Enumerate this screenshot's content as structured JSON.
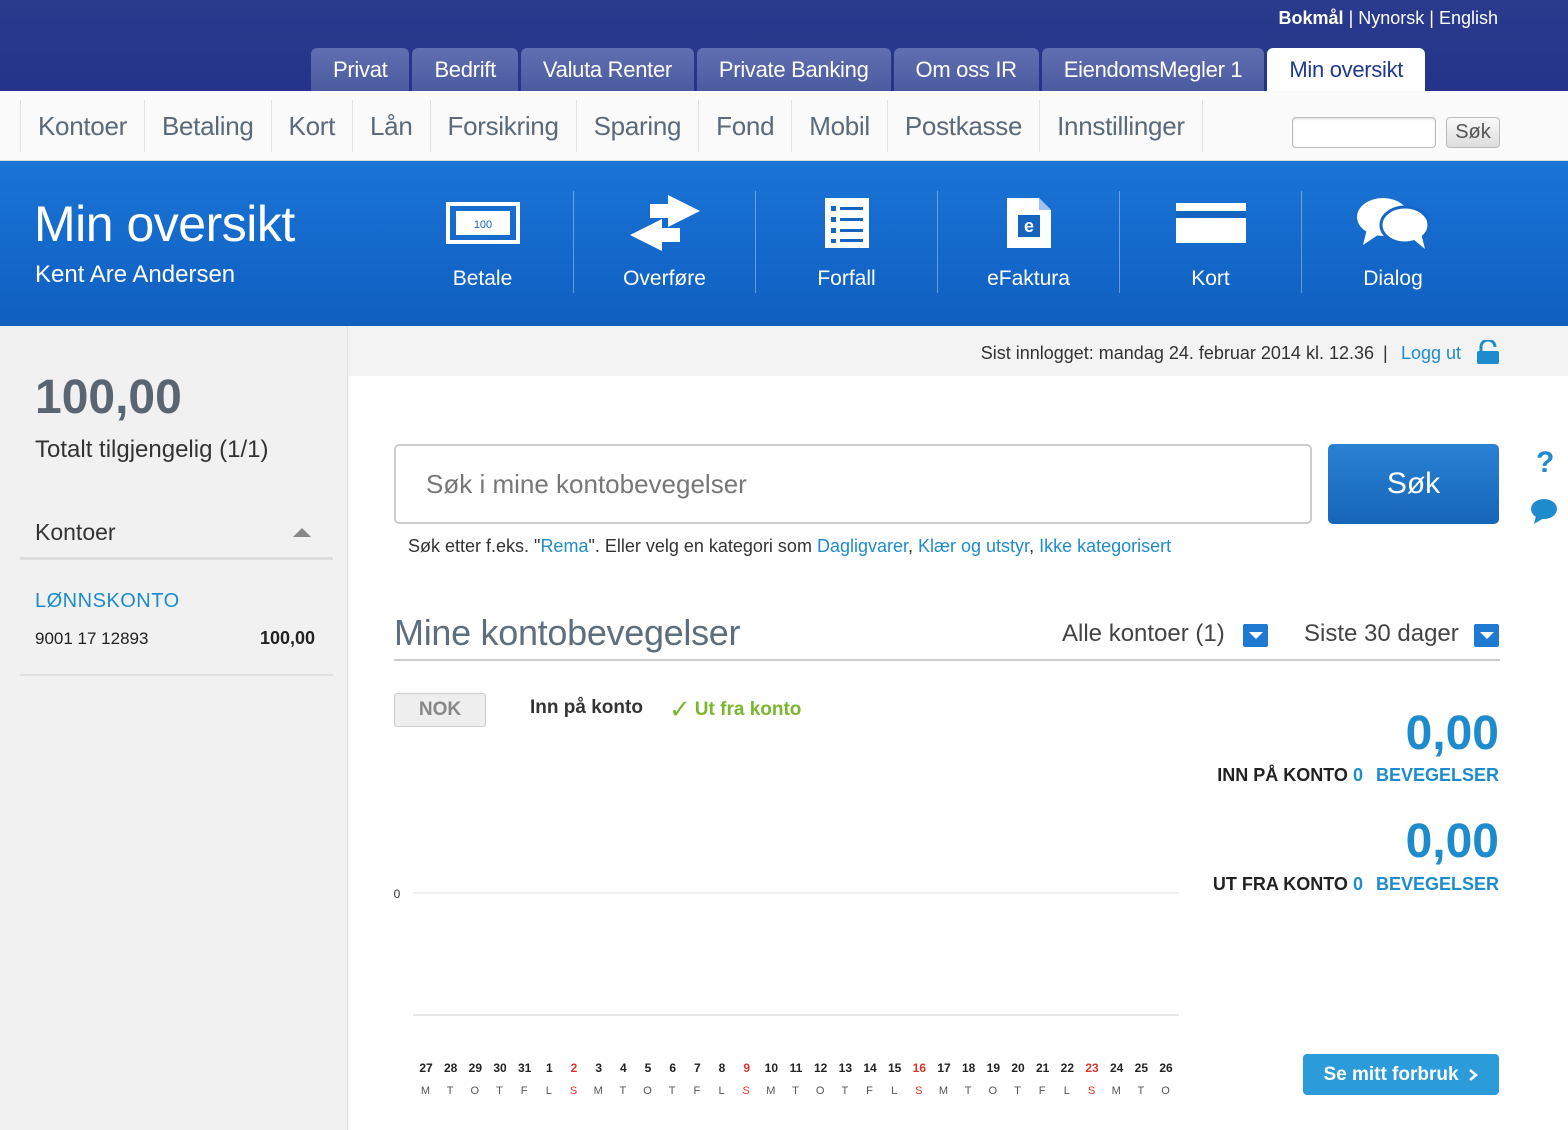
{
  "languages": [
    {
      "label": "Bokmål",
      "active": true
    },
    {
      "label": "Nynorsk",
      "active": false
    },
    {
      "label": "English",
      "active": false
    }
  ],
  "lang_separator": "|",
  "top_tabs": [
    "Privat",
    "Bedrift",
    "Valuta Renter",
    "Private Banking",
    "Om oss IR",
    "EiendomsMegler 1",
    "Min oversikt"
  ],
  "top_tabs_active": "Min oversikt",
  "subnav": [
    "Kontoer",
    "Betaling",
    "Kort",
    "Lån",
    "Forsikring",
    "Sparing",
    "Fond",
    "Mobil",
    "Postkasse",
    "Innstillinger"
  ],
  "top_search": {
    "value": "",
    "button": "Søk"
  },
  "banner": {
    "title": "Min oversikt",
    "user": "Kent Are Andersen",
    "actions": [
      {
        "label": "Betale",
        "icon": "banknote-icon",
        "note_text": "100"
      },
      {
        "label": "Overføre",
        "icon": "transfer-arrows-icon"
      },
      {
        "label": "Forfall",
        "icon": "list-document-icon"
      },
      {
        "label": "eFaktura",
        "icon": "efaktura-document-icon",
        "icon_text": "e"
      },
      {
        "label": "Kort",
        "icon": "card-icon"
      },
      {
        "label": "Dialog",
        "icon": "chat-bubbles-icon"
      }
    ]
  },
  "sidebar": {
    "total": "100,00",
    "total_label": "Totalt tilgjengelig (1/1)",
    "accounts_header": "Kontoer",
    "account": {
      "name": "LØNNSKONTO",
      "number": "9001 17 12893",
      "balance": "100,00"
    }
  },
  "status": {
    "last_login": "Sist innlogget: mandag 24. februar 2014 kl. 12.36",
    "separator": "|",
    "logout": "Logg ut"
  },
  "search": {
    "placeholder": "Søk i mine kontobevegelser",
    "button": "Søk",
    "hint_prefix": "Søk etter f.eks. \"",
    "hint_example": "Rema",
    "hint_middle": "\". Eller velg en kategori som ",
    "categories": [
      "Dagligvarer",
      "Klær og utstyr",
      "Ikke kategorisert"
    ],
    "comma": ", "
  },
  "help": {
    "question": "?"
  },
  "movements": {
    "title": "Mine kontobevegelser",
    "account_filter": "Alle kontoer (1)",
    "period_filter": "Siste 30 dager",
    "currency": "NOK",
    "tab_in": "Inn på konto",
    "tab_out": "Ut fra konto",
    "tab_out_check": "✓",
    "in_amount": "0,00",
    "in_label": "INN PÅ KONTO",
    "in_count": "0",
    "out_amount": "0,00",
    "out_label": "UT FRA KONTO",
    "out_count": "0",
    "movements_word": "BEVEGELSER",
    "forbruk_button": "Se mitt forbruk"
  },
  "chart_data": {
    "type": "bar",
    "ytick": "0",
    "categories": [
      "27",
      "28",
      "29",
      "30",
      "31",
      "1",
      "2",
      "3",
      "4",
      "5",
      "6",
      "7",
      "8",
      "9",
      "10",
      "11",
      "12",
      "13",
      "14",
      "15",
      "16",
      "17",
      "18",
      "19",
      "20",
      "21",
      "22",
      "23",
      "24",
      "25",
      "26"
    ],
    "weekdays": [
      "M",
      "T",
      "O",
      "T",
      "F",
      "L",
      "S",
      "M",
      "T",
      "O",
      "T",
      "F",
      "L",
      "S",
      "M",
      "T",
      "O",
      "T",
      "F",
      "L",
      "S",
      "M",
      "T",
      "O",
      "T",
      "F",
      "L",
      "S",
      "M",
      "T",
      "O"
    ],
    "sundays": [
      "2",
      "9",
      "16",
      "23"
    ],
    "values": [
      0,
      0,
      0,
      0,
      0,
      0,
      0,
      0,
      0,
      0,
      0,
      0,
      0,
      0,
      0,
      0,
      0,
      0,
      0,
      0,
      0,
      0,
      0,
      0,
      0,
      0,
      0,
      0,
      0,
      0,
      0
    ],
    "colors": {
      "normal": "#222222",
      "sunday": "#d9342b",
      "grid": "#e6e6e6"
    }
  }
}
